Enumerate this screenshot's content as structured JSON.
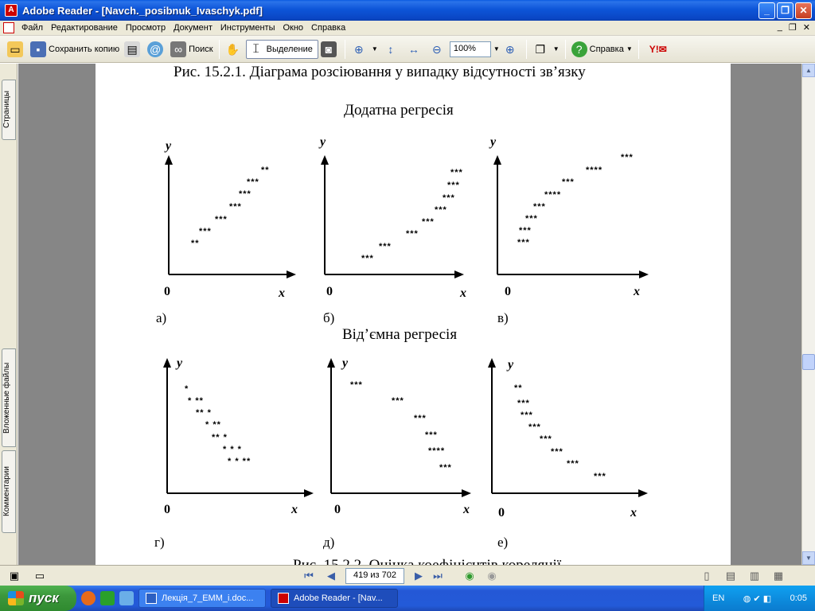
{
  "window": {
    "title": "Adobe Reader - [Navch._posibnuk_Ivaschyk.pdf]",
    "app_icon": "adobe-reader-icon",
    "buttons": [
      "minimize",
      "maximize",
      "close"
    ]
  },
  "menu": {
    "items": [
      "Файл",
      "Редактирование",
      "Просмотр",
      "Документ",
      "Инструменты",
      "Окно",
      "Справка"
    ]
  },
  "toolbar": {
    "save_copy": "Сохранить копию",
    "search": "Поиск",
    "select": "Выделение",
    "zoom": "100%",
    "help": "Справка"
  },
  "left_tabs": {
    "pages": "Страницы",
    "attachments": "Вложенные файлы",
    "comments": "Комментарии"
  },
  "document": {
    "top_caption": "Рис. 15.2.1. Діаграма розсіювання у випадку відсутності зв’язку",
    "positive_title": "Додатна регресія",
    "negative_title": "Від’ємна регресія",
    "bottom_caption_partial": "Рис. 15.2.2. Оцінка коефіцієнтів кореляції",
    "axis_x": "x",
    "axis_y": "y",
    "origin": "0",
    "plots": [
      {
        "label": "а)",
        "rows": [
          "**",
          "***",
          "***",
          "***",
          "***",
          "***",
          "**"
        ]
      },
      {
        "label": "б)",
        "rows": [
          "***",
          "***",
          "***",
          "***",
          "***",
          "***",
          "***",
          "***"
        ]
      },
      {
        "label": "в)",
        "rows": [
          "***",
          "****",
          "***",
          "****",
          "***",
          "***",
          "***",
          "***"
        ]
      },
      {
        "label": "г)",
        "rows": [
          "*",
          "* **",
          "** *",
          "* **",
          "** *",
          "* * *",
          "* * **"
        ]
      },
      {
        "label": "д)",
        "rows": [
          "***",
          "***",
          "***",
          "***",
          "****",
          "***"
        ]
      },
      {
        "label": "е)",
        "rows": [
          "**",
          "***",
          "***",
          "***",
          "***",
          "***",
          "***",
          "***"
        ]
      }
    ]
  },
  "navigation": {
    "page": "419 из 702"
  },
  "taskbar": {
    "start": "пуск",
    "items": [
      "Лекція_7_EMM_i.doc...",
      "Adobe Reader - [Nav..."
    ],
    "lang": "EN",
    "time": "0:05"
  }
}
